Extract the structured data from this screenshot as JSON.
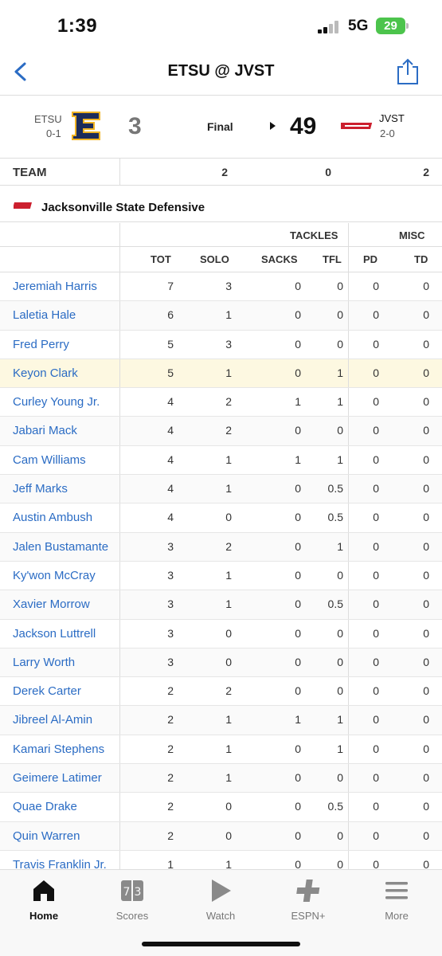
{
  "status_bar": {
    "time": "1:39",
    "network": "5G",
    "battery": "29"
  },
  "nav": {
    "title": "ETSU @ JVST"
  },
  "game": {
    "away": {
      "abbr": "ETSU",
      "record": "0-1",
      "score": "3"
    },
    "home": {
      "abbr": "JVST",
      "record": "2-0",
      "score": "49"
    },
    "status": "Final"
  },
  "team_row": {
    "label": "TEAM",
    "values": [
      "2",
      "0",
      "2"
    ]
  },
  "section": {
    "title": "Jacksonville State Defensive"
  },
  "table": {
    "groups": [
      "TACKLES",
      "MISC"
    ],
    "columns": [
      "TOT",
      "SOLO",
      "SACKS",
      "TFL",
      "PD",
      "TD"
    ],
    "rows": [
      {
        "name": "Jeremiah Harris",
        "stats": [
          "7",
          "3",
          "0",
          "0",
          "0",
          "0"
        ]
      },
      {
        "name": "Laletia Hale",
        "stats": [
          "6",
          "1",
          "0",
          "0",
          "0",
          "0"
        ]
      },
      {
        "name": "Fred Perry",
        "stats": [
          "5",
          "3",
          "0",
          "0",
          "0",
          "0"
        ]
      },
      {
        "name": "Keyon Clark",
        "stats": [
          "5",
          "1",
          "0",
          "1",
          "0",
          "0"
        ],
        "highlight": true
      },
      {
        "name": "Curley Young Jr.",
        "stats": [
          "4",
          "2",
          "1",
          "1",
          "0",
          "0"
        ]
      },
      {
        "name": "Jabari Mack",
        "stats": [
          "4",
          "2",
          "0",
          "0",
          "0",
          "0"
        ]
      },
      {
        "name": "Cam Williams",
        "stats": [
          "4",
          "1",
          "1",
          "1",
          "0",
          "0"
        ]
      },
      {
        "name": "Jeff Marks",
        "stats": [
          "4",
          "1",
          "0",
          "0.5",
          "0",
          "0"
        ]
      },
      {
        "name": "Austin Ambush",
        "stats": [
          "4",
          "0",
          "0",
          "0.5",
          "0",
          "0"
        ]
      },
      {
        "name": "Jalen Bustamante",
        "stats": [
          "3",
          "2",
          "0",
          "1",
          "0",
          "0"
        ]
      },
      {
        "name": "Ky'won McCray",
        "stats": [
          "3",
          "1",
          "0",
          "0",
          "0",
          "0"
        ]
      },
      {
        "name": "Xavier Morrow",
        "stats": [
          "3",
          "1",
          "0",
          "0.5",
          "0",
          "0"
        ]
      },
      {
        "name": "Jackson Luttrell",
        "stats": [
          "3",
          "0",
          "0",
          "0",
          "0",
          "0"
        ]
      },
      {
        "name": "Larry Worth",
        "stats": [
          "3",
          "0",
          "0",
          "0",
          "0",
          "0"
        ]
      },
      {
        "name": "Derek Carter",
        "stats": [
          "2",
          "2",
          "0",
          "0",
          "0",
          "0"
        ]
      },
      {
        "name": "Jibreel Al-Amin",
        "stats": [
          "2",
          "1",
          "1",
          "1",
          "0",
          "0"
        ]
      },
      {
        "name": "Kamari Stephens",
        "stats": [
          "2",
          "1",
          "0",
          "1",
          "0",
          "0"
        ]
      },
      {
        "name": "Geimere Latimer",
        "stats": [
          "2",
          "1",
          "0",
          "0",
          "0",
          "0"
        ]
      },
      {
        "name": "Quae Drake",
        "stats": [
          "2",
          "0",
          "0",
          "0.5",
          "0",
          "0"
        ]
      },
      {
        "name": "Quin Warren",
        "stats": [
          "2",
          "0",
          "0",
          "0",
          "0",
          "0"
        ]
      },
      {
        "name": "Travis Franklin Jr.",
        "stats": [
          "1",
          "1",
          "0",
          "0",
          "0",
          "0"
        ]
      }
    ]
  },
  "tabs": [
    {
      "label": "Home",
      "icon": "home-icon",
      "active": true
    },
    {
      "label": "Scores",
      "icon": "scores-icon",
      "active": false
    },
    {
      "label": "Watch",
      "icon": "play-icon",
      "active": false
    },
    {
      "label": "ESPN+",
      "icon": "plus-icon",
      "active": false
    },
    {
      "label": "More",
      "icon": "menu-icon",
      "active": false
    }
  ],
  "colors": {
    "link": "#2b6cc4",
    "highlight_row": "#fdf8e1",
    "battery": "#4cc44c",
    "etsu_navy": "#1c2b5a",
    "etsu_gold": "#f0b323",
    "jvst_red": "#cc1f2e"
  }
}
